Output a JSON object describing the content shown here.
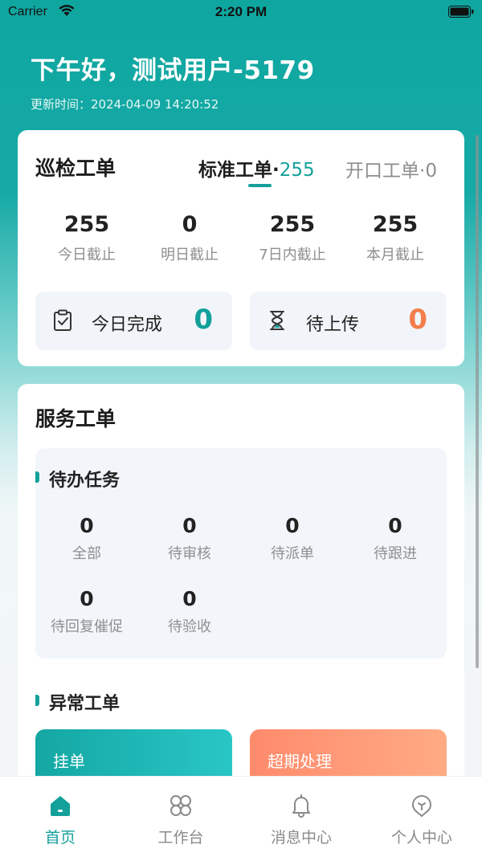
{
  "status_bar": {
    "carrier": "Carrier",
    "time": "2:20 PM"
  },
  "header": {
    "greeting": "下午好，测试用户-5179",
    "update_time": "更新时间：2024-04-09 14:20:52"
  },
  "inspection": {
    "title": "巡检工单",
    "tabs": [
      {
        "label": "标准工单",
        "separator": "·",
        "count": "255",
        "active": true
      },
      {
        "label": "开口工单",
        "separator": "·",
        "count": "0",
        "active": false
      }
    ],
    "stats": [
      {
        "value": "255",
        "label": "今日截止"
      },
      {
        "value": "0",
        "label": "明日截止"
      },
      {
        "value": "255",
        "label": "7日内截止"
      },
      {
        "value": "255",
        "label": "本月截止"
      }
    ],
    "today_done": {
      "label": "今日完成",
      "value": "0",
      "color": "#13a09b",
      "icon": "clipboard-check-icon"
    },
    "pending_upload": {
      "label": "待上传",
      "value": "0",
      "color": "#f47e4b",
      "icon": "hourglass-icon"
    }
  },
  "service": {
    "title": "服务工单",
    "todo": {
      "title": "待办任务",
      "items": [
        {
          "value": "0",
          "label": "全部"
        },
        {
          "value": "0",
          "label": "待审核"
        },
        {
          "value": "0",
          "label": "待派单"
        },
        {
          "value": "0",
          "label": "待跟进"
        },
        {
          "value": "0",
          "label": "待回复催促"
        },
        {
          "value": "0",
          "label": "待验收"
        }
      ]
    },
    "anomaly": {
      "title": "异常工单",
      "cards": [
        {
          "label": "挂单",
          "color": "#14a7a3"
        },
        {
          "label": "超期处理",
          "color": "#ff8a6c"
        }
      ]
    }
  },
  "tabbar": {
    "items": [
      {
        "label": "首页",
        "icon": "home-icon",
        "active": true
      },
      {
        "label": "工作台",
        "icon": "workbench-icon",
        "active": false
      },
      {
        "label": "消息中心",
        "icon": "bell-icon",
        "active": false
      },
      {
        "label": "个人中心",
        "icon": "profile-icon",
        "active": false
      }
    ]
  },
  "colors": {
    "accent": "#13a09b",
    "warning": "#f47e4b"
  }
}
